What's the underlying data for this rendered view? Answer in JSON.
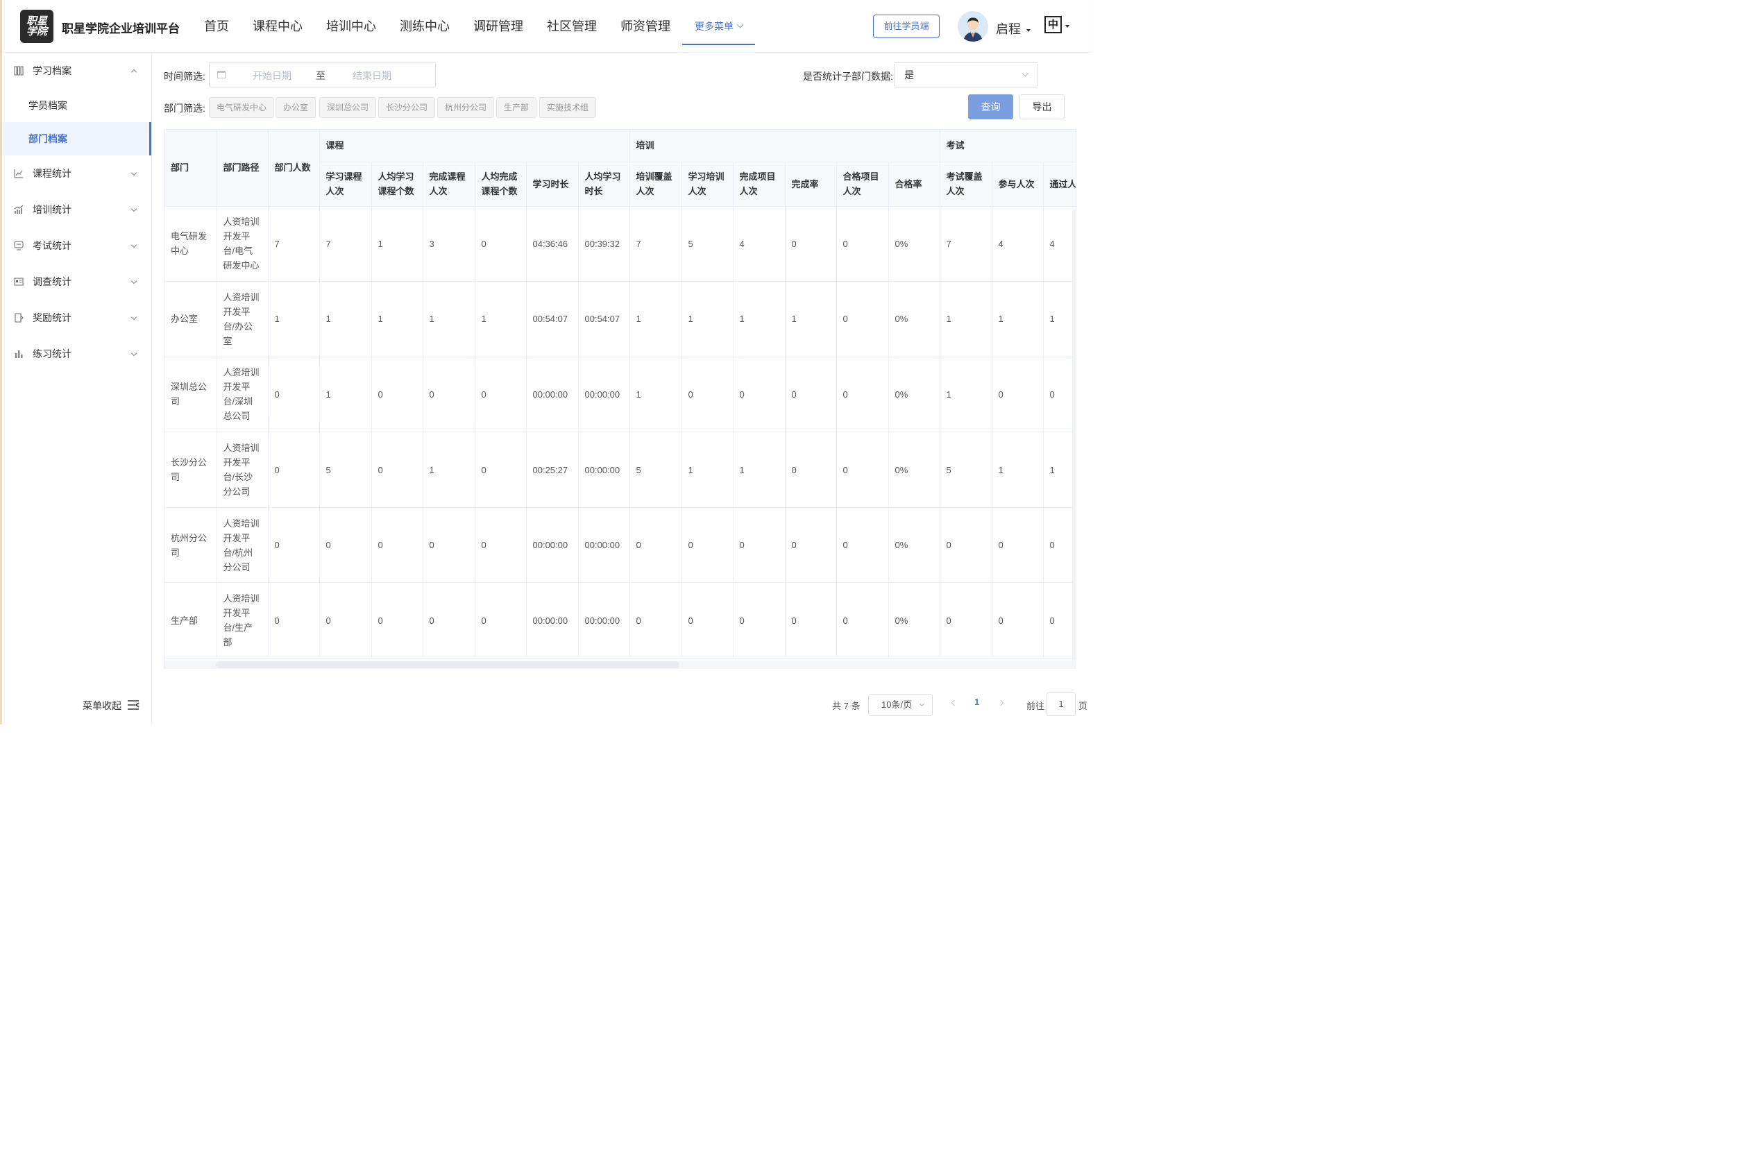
{
  "header": {
    "logo_text": "职星学院",
    "brand": "职星学院企业培训平台",
    "nav": [
      "首页",
      "课程中心",
      "培训中心",
      "测练中心",
      "调研管理",
      "社区管理",
      "师资管理"
    ],
    "more_menu": "更多菜单",
    "student_button": "前往学员端",
    "username": "启程",
    "lang": "中",
    "accent_color": "#4a74c9"
  },
  "sidebar": {
    "group_learning": "学习档案",
    "sub_student": "学员档案",
    "sub_dept": "部门档案",
    "course_stats": "课程统计",
    "training_stats": "培训统计",
    "exam_stats": "考试统计",
    "survey_stats": "调查统计",
    "reward_stats": "奖励统计",
    "practice_stats": "练习统计",
    "collapse": "菜单收起"
  },
  "filters": {
    "time_label": "时间筛选:",
    "start_placeholder": "开始日期",
    "to": "至",
    "end_placeholder": "结束日期",
    "sub_dept_label": "是否统计子部门数据:",
    "sub_dept_value": "是",
    "dept_label": "部门筛选:",
    "dept_tags": [
      "电气研发中心",
      "办公室",
      "深圳总公司",
      "长沙分公司",
      "杭州分公司",
      "生产部",
      "实施技术组"
    ],
    "query": "查询",
    "export": "导出"
  },
  "table": {
    "col_dept": "部门",
    "col_path": "部门路径",
    "col_count": "部门人数",
    "grp_course": "课程",
    "grp_training": "培训",
    "grp_exam": "考试",
    "course_cols": [
      "学习课程人次",
      "人均学习课程个数",
      "完成课程人次",
      "人均完成课程个数",
      "学习时长",
      "人均学习时长"
    ],
    "training_cols": [
      "培训覆盖人次",
      "学习培训人次",
      "完成项目人次",
      "完成率",
      "合格项目人次",
      "合格率"
    ],
    "exam_cols": [
      "考试覆盖人次",
      "参与人次",
      "通过人次"
    ],
    "rows": [
      {
        "dept": "电气研发中心",
        "path": "人资培训开发平台/电气研发中心",
        "values": [
          "7",
          "7",
          "1",
          "3",
          "0",
          "04:36:46",
          "00:39:32",
          "7",
          "5",
          "4",
          "0",
          "0",
          "0%",
          "7",
          "4",
          "4"
        ]
      },
      {
        "dept": "办公室",
        "path": "人资培训开发平台/办公室",
        "values": [
          "1",
          "1",
          "1",
          "1",
          "1",
          "00:54:07",
          "00:54:07",
          "1",
          "1",
          "1",
          "1",
          "0",
          "0%",
          "1",
          "1",
          "1"
        ]
      },
      {
        "dept": "深圳总公司",
        "path": "人资培训开发平台/深圳总公司",
        "values": [
          "0",
          "1",
          "0",
          "0",
          "0",
          "00:00:00",
          "00:00:00",
          "1",
          "0",
          "0",
          "0",
          "0",
          "0%",
          "1",
          "0",
          "0"
        ]
      },
      {
        "dept": "长沙分公司",
        "path": "人资培训开发平台/长沙分公司",
        "values": [
          "0",
          "5",
          "0",
          "1",
          "0",
          "00:25:27",
          "00:00:00",
          "5",
          "1",
          "1",
          "0",
          "0",
          "0%",
          "5",
          "1",
          "1"
        ]
      },
      {
        "dept": "杭州分公司",
        "path": "人资培训开发平台/杭州分公司",
        "values": [
          "0",
          "0",
          "0",
          "0",
          "0",
          "00:00:00",
          "00:00:00",
          "0",
          "0",
          "0",
          "0",
          "0",
          "0%",
          "0",
          "0",
          "0"
        ]
      },
      {
        "dept": "生产部",
        "path": "人资培训开发平台/生产部",
        "values": [
          "0",
          "0",
          "0",
          "0",
          "0",
          "00:00:00",
          "00:00:00",
          "0",
          "0",
          "0",
          "0",
          "0",
          "0%",
          "0",
          "0",
          "0"
        ]
      }
    ]
  },
  "pager": {
    "total": "共 7 条",
    "page_size": "10条/页",
    "current": "1",
    "goto_label": "前往",
    "goto_value": "1",
    "page_unit": "页"
  }
}
